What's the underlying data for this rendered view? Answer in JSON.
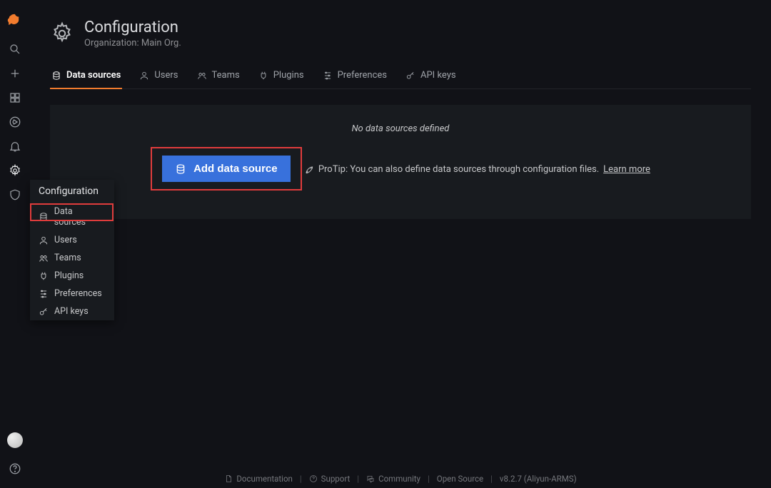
{
  "page": {
    "title": "Configuration",
    "subtitle": "Organization: Main Org."
  },
  "tabs": [
    {
      "label": "Data sources"
    },
    {
      "label": "Users"
    },
    {
      "label": "Teams"
    },
    {
      "label": "Plugins"
    },
    {
      "label": "Preferences"
    },
    {
      "label": "API keys"
    }
  ],
  "panel": {
    "empty_text": "No data sources defined",
    "add_button": "Add data source",
    "protip_prefix": "ProTip: You can also define data sources through configuration files. ",
    "protip_link": "Learn more"
  },
  "flyout": {
    "title": "Configuration",
    "items": [
      {
        "label": "Data sources"
      },
      {
        "label": "Users"
      },
      {
        "label": "Teams"
      },
      {
        "label": "Plugins"
      },
      {
        "label": "Preferences"
      },
      {
        "label": "API keys"
      }
    ]
  },
  "footer": {
    "documentation": "Documentation",
    "support": "Support",
    "community": "Community",
    "opensource": "Open Source",
    "version": "v8.2.7 (Aliyun-ARMS)"
  }
}
